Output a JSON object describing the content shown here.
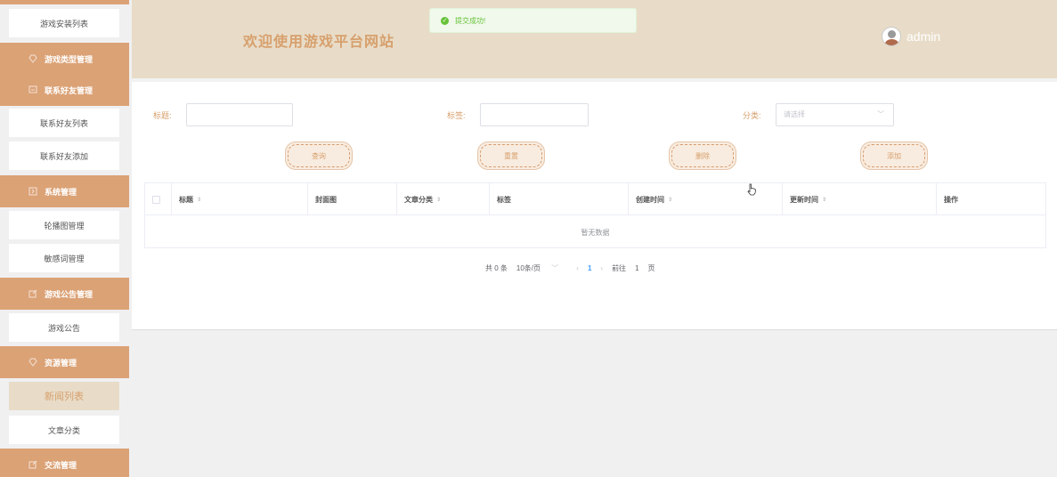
{
  "header": {
    "title": "欢迎使用游戏平台网站",
    "username": "admin"
  },
  "toast": {
    "message": "提交成功!"
  },
  "sidebar": {
    "items": [
      {
        "type": "item",
        "label": "游戏安装列表"
      },
      {
        "type": "group",
        "label": "游戏类型管理",
        "icon": "diamond-icon"
      },
      {
        "type": "group",
        "label": "联系好友管理",
        "icon": "chat-icon"
      },
      {
        "type": "item",
        "label": "联系好友列表"
      },
      {
        "type": "item",
        "label": "联系好友添加"
      },
      {
        "type": "group",
        "label": "系统管理",
        "icon": "system-icon"
      },
      {
        "type": "item",
        "label": "轮播图管理"
      },
      {
        "type": "item",
        "label": "敏感词管理"
      },
      {
        "type": "group",
        "label": "游戏公告管理",
        "icon": "edit-icon"
      },
      {
        "type": "item",
        "label": "游戏公告"
      },
      {
        "type": "group",
        "label": "资源管理",
        "icon": "diamond-icon"
      },
      {
        "type": "item",
        "label": "新闻列表",
        "active": true
      },
      {
        "type": "item",
        "label": "文章分类"
      },
      {
        "type": "group",
        "label": "交流管理",
        "icon": "edit-icon"
      }
    ]
  },
  "search": {
    "title_label": "标题:",
    "title_value": "",
    "tag_label": "标签:",
    "tag_value": "",
    "category_label": "分类:",
    "category_placeholder": "请选择"
  },
  "buttons": {
    "query": "查询",
    "reset": "重置",
    "delete": "删除",
    "add": "添加"
  },
  "table": {
    "columns": [
      "标题",
      "封面图",
      "文章分类",
      "标签",
      "创建时间",
      "更新时间",
      "操作"
    ],
    "empty_text": "暂无数据"
  },
  "pagination": {
    "total": "共 0 条",
    "page_size": "10条/页",
    "current_page": "1",
    "goto_prefix": "前往",
    "goto_value": "1",
    "goto_suffix": "页"
  },
  "colors": {
    "accent": "#dba276",
    "header_bg": "#e8dcc8",
    "title": "#d7a06d",
    "success": "#67c23a"
  }
}
